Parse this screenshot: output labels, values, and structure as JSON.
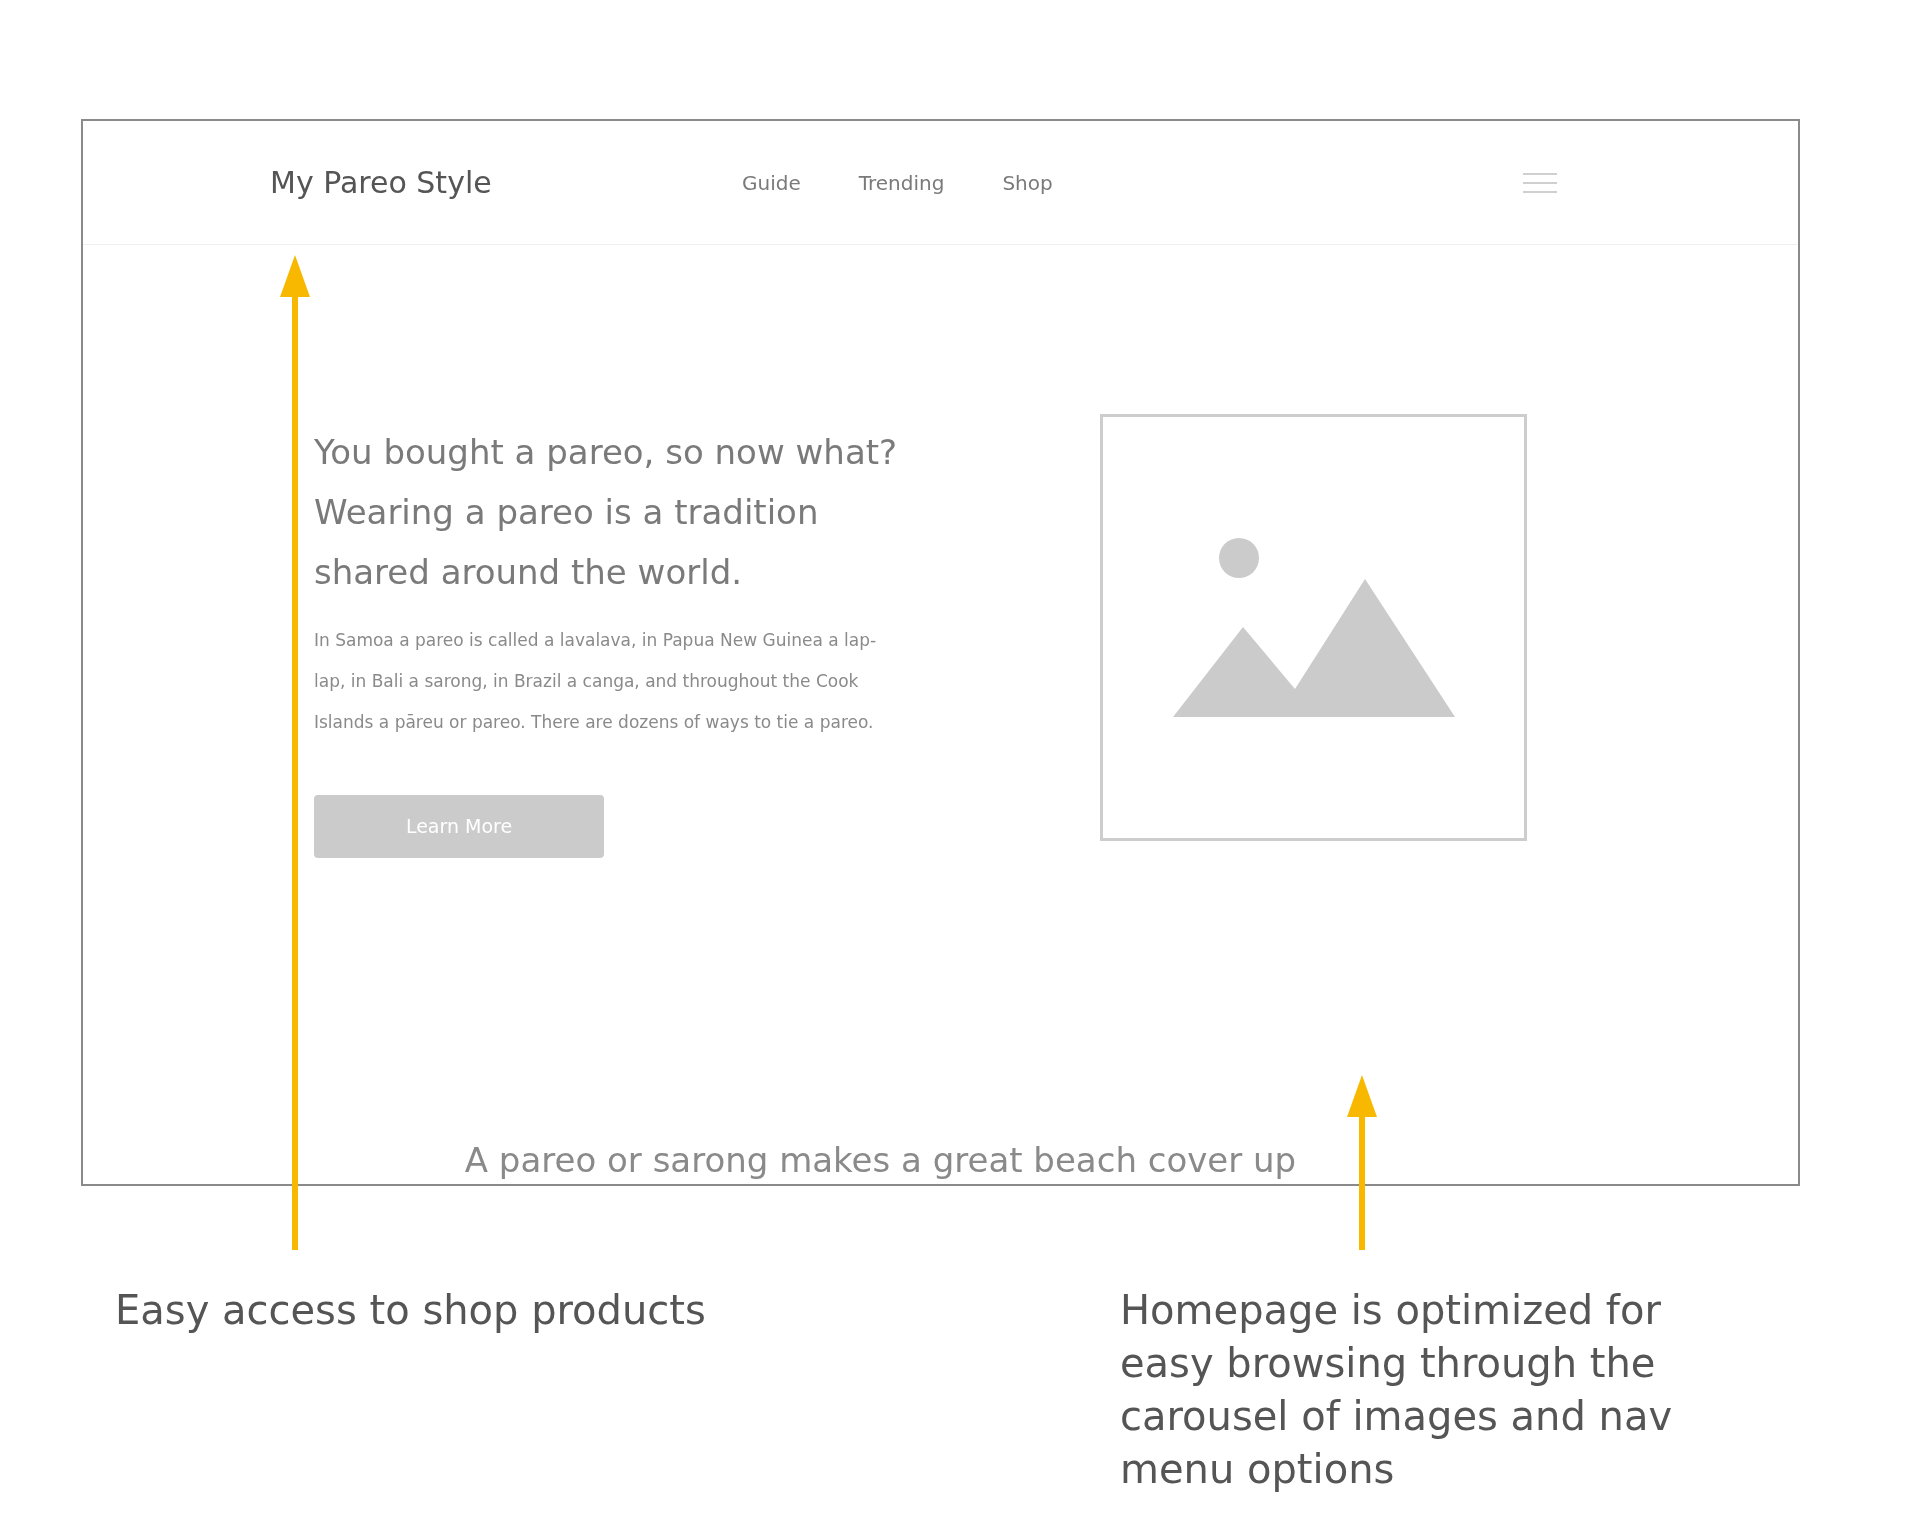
{
  "site": {
    "logo": "My Pareo Style",
    "nav": [
      {
        "label": "Guide"
      },
      {
        "label": "Trending"
      },
      {
        "label": "Shop"
      }
    ],
    "hero": {
      "heading": [
        "You bought a pareo, so now what?",
        "Wearing a pareo is a tradition",
        "shared around the world."
      ],
      "body": "In Samoa a pareo is called a lavalava, in Papua New Guinea a lap-lap, in Bali a sarong, in Brazil a canga, and throughout the Cook Islands a pāreu or pareo. There are dozens of ways to tie a pareo.",
      "button": "Learn More"
    },
    "next_heading": "A pareo or sarong makes a great beach cover up"
  },
  "annotations": [
    {
      "text": "Easy access to shop products"
    },
    {
      "text": "Homepage is optimized for easy browsing through the carousel of images and nav menu options"
    }
  ]
}
